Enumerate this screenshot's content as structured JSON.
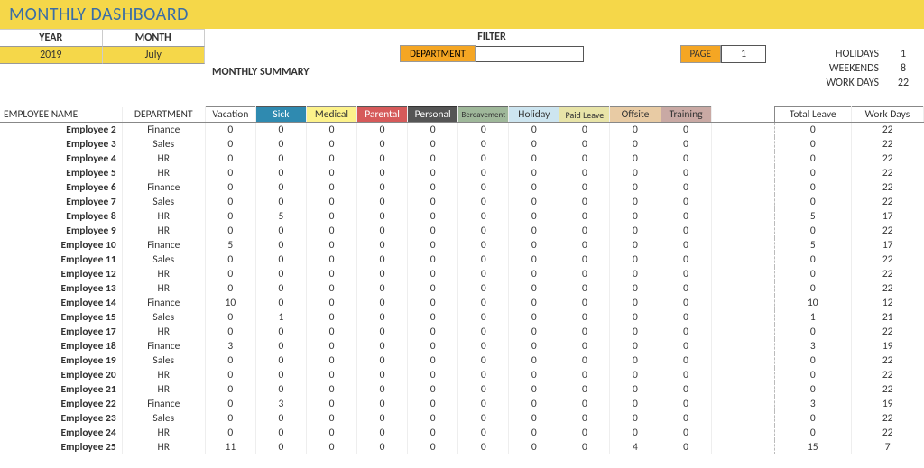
{
  "title": "MONTHLY DASHBOARD",
  "year_month": {
    "year_label": "YEAR",
    "month_label": "MONTH",
    "year_value": "2019",
    "month_value": "July"
  },
  "filter": {
    "title": "FILTER",
    "dept_label": "DEPARTMENT",
    "dept_value": "",
    "page_label": "PAGE",
    "page_value": "1"
  },
  "summary_label": "MONTHLY SUMMARY",
  "stats": {
    "holidays_label": "HOLIDAYS",
    "holidays_value": "1",
    "weekends_label": "WEEKENDS",
    "weekends_value": "8",
    "workdays_label": "WORK DAYS",
    "workdays_value": "22"
  },
  "headers": {
    "employee": "EMPLOYEE NAME",
    "department": "DEPARTMENT",
    "vacation": "Vacation",
    "sick": "Sick",
    "medical": "Medical",
    "parental": "Parental",
    "personal": "Personal",
    "bereavement": "Bereavement",
    "holiday": "Holiday",
    "paid_leave": "Paid Leave",
    "offsite": "Offsite",
    "training": "Training",
    "total_leave": "Total Leave",
    "work_days": "Work Days"
  },
  "rows": [
    {
      "name": "Employee 2",
      "dept": "Finance",
      "v": [
        "0",
        "0",
        "0",
        "0",
        "0",
        "0",
        "0",
        "0",
        "0",
        "0"
      ],
      "total": "0",
      "work": "22"
    },
    {
      "name": "Employee 3",
      "dept": "Sales",
      "v": [
        "0",
        "0",
        "0",
        "0",
        "0",
        "0",
        "0",
        "0",
        "0",
        "0"
      ],
      "total": "0",
      "work": "22"
    },
    {
      "name": "Employee 4",
      "dept": "HR",
      "v": [
        "0",
        "0",
        "0",
        "0",
        "0",
        "0",
        "0",
        "0",
        "0",
        "0"
      ],
      "total": "0",
      "work": "22"
    },
    {
      "name": "Employee 5",
      "dept": "HR",
      "v": [
        "0",
        "0",
        "0",
        "0",
        "0",
        "0",
        "0",
        "0",
        "0",
        "0"
      ],
      "total": "0",
      "work": "22"
    },
    {
      "name": "Employee 6",
      "dept": "Finance",
      "v": [
        "0",
        "0",
        "0",
        "0",
        "0",
        "0",
        "0",
        "0",
        "0",
        "0"
      ],
      "total": "0",
      "work": "22"
    },
    {
      "name": "Employee 7",
      "dept": "Sales",
      "v": [
        "0",
        "0",
        "0",
        "0",
        "0",
        "0",
        "0",
        "0",
        "0",
        "0"
      ],
      "total": "0",
      "work": "22"
    },
    {
      "name": "Employee 8",
      "dept": "HR",
      "v": [
        "0",
        "5",
        "0",
        "0",
        "0",
        "0",
        "0",
        "0",
        "0",
        "0"
      ],
      "total": "5",
      "work": "17"
    },
    {
      "name": "Employee 9",
      "dept": "HR",
      "v": [
        "0",
        "0",
        "0",
        "0",
        "0",
        "0",
        "0",
        "0",
        "0",
        "0"
      ],
      "total": "0",
      "work": "22"
    },
    {
      "name": "Employee 10",
      "dept": "Finance",
      "v": [
        "5",
        "0",
        "0",
        "0",
        "0",
        "0",
        "0",
        "0",
        "0",
        "0"
      ],
      "total": "5",
      "work": "17"
    },
    {
      "name": "Employee 11",
      "dept": "Sales",
      "v": [
        "0",
        "0",
        "0",
        "0",
        "0",
        "0",
        "0",
        "0",
        "0",
        "0"
      ],
      "total": "0",
      "work": "22"
    },
    {
      "name": "Employee 12",
      "dept": "HR",
      "v": [
        "0",
        "0",
        "0",
        "0",
        "0",
        "0",
        "0",
        "0",
        "0",
        "0"
      ],
      "total": "0",
      "work": "22"
    },
    {
      "name": "Employee 13",
      "dept": "HR",
      "v": [
        "0",
        "0",
        "0",
        "0",
        "0",
        "0",
        "0",
        "0",
        "0",
        "0"
      ],
      "total": "0",
      "work": "22"
    },
    {
      "name": "Employee 14",
      "dept": "Finance",
      "v": [
        "10",
        "0",
        "0",
        "0",
        "0",
        "0",
        "0",
        "0",
        "0",
        "0"
      ],
      "total": "10",
      "work": "12"
    },
    {
      "name": "Employee 15",
      "dept": "Sales",
      "v": [
        "0",
        "1",
        "0",
        "0",
        "0",
        "0",
        "0",
        "0",
        "0",
        "0"
      ],
      "total": "1",
      "work": "21"
    },
    {
      "name": "Employee 17",
      "dept": "HR",
      "v": [
        "0",
        "0",
        "0",
        "0",
        "0",
        "0",
        "0",
        "0",
        "0",
        "0"
      ],
      "total": "0",
      "work": "22"
    },
    {
      "name": "Employee 18",
      "dept": "Finance",
      "v": [
        "3",
        "0",
        "0",
        "0",
        "0",
        "0",
        "0",
        "0",
        "0",
        "0"
      ],
      "total": "3",
      "work": "19"
    },
    {
      "name": "Employee 19",
      "dept": "Sales",
      "v": [
        "0",
        "0",
        "0",
        "0",
        "0",
        "0",
        "0",
        "0",
        "0",
        "0"
      ],
      "total": "0",
      "work": "22"
    },
    {
      "name": "Employee 20",
      "dept": "HR",
      "v": [
        "0",
        "0",
        "0",
        "0",
        "0",
        "0",
        "0",
        "0",
        "0",
        "0"
      ],
      "total": "0",
      "work": "22"
    },
    {
      "name": "Employee 21",
      "dept": "HR",
      "v": [
        "0",
        "0",
        "0",
        "0",
        "0",
        "0",
        "0",
        "0",
        "0",
        "0"
      ],
      "total": "0",
      "work": "22"
    },
    {
      "name": "Employee 22",
      "dept": "Finance",
      "v": [
        "0",
        "3",
        "0",
        "0",
        "0",
        "0",
        "0",
        "0",
        "0",
        "0"
      ],
      "total": "3",
      "work": "19"
    },
    {
      "name": "Employee 23",
      "dept": "Sales",
      "v": [
        "0",
        "0",
        "0",
        "0",
        "0",
        "0",
        "0",
        "0",
        "0",
        "0"
      ],
      "total": "0",
      "work": "22"
    },
    {
      "name": "Employee 24",
      "dept": "HR",
      "v": [
        "0",
        "0",
        "0",
        "0",
        "0",
        "0",
        "0",
        "0",
        "0",
        "0"
      ],
      "total": "0",
      "work": "22"
    },
    {
      "name": "Employee 25",
      "dept": "HR",
      "v": [
        "11",
        "0",
        "0",
        "0",
        "0",
        "0",
        "0",
        "0",
        "4",
        "0"
      ],
      "total": "15",
      "work": "7"
    }
  ]
}
